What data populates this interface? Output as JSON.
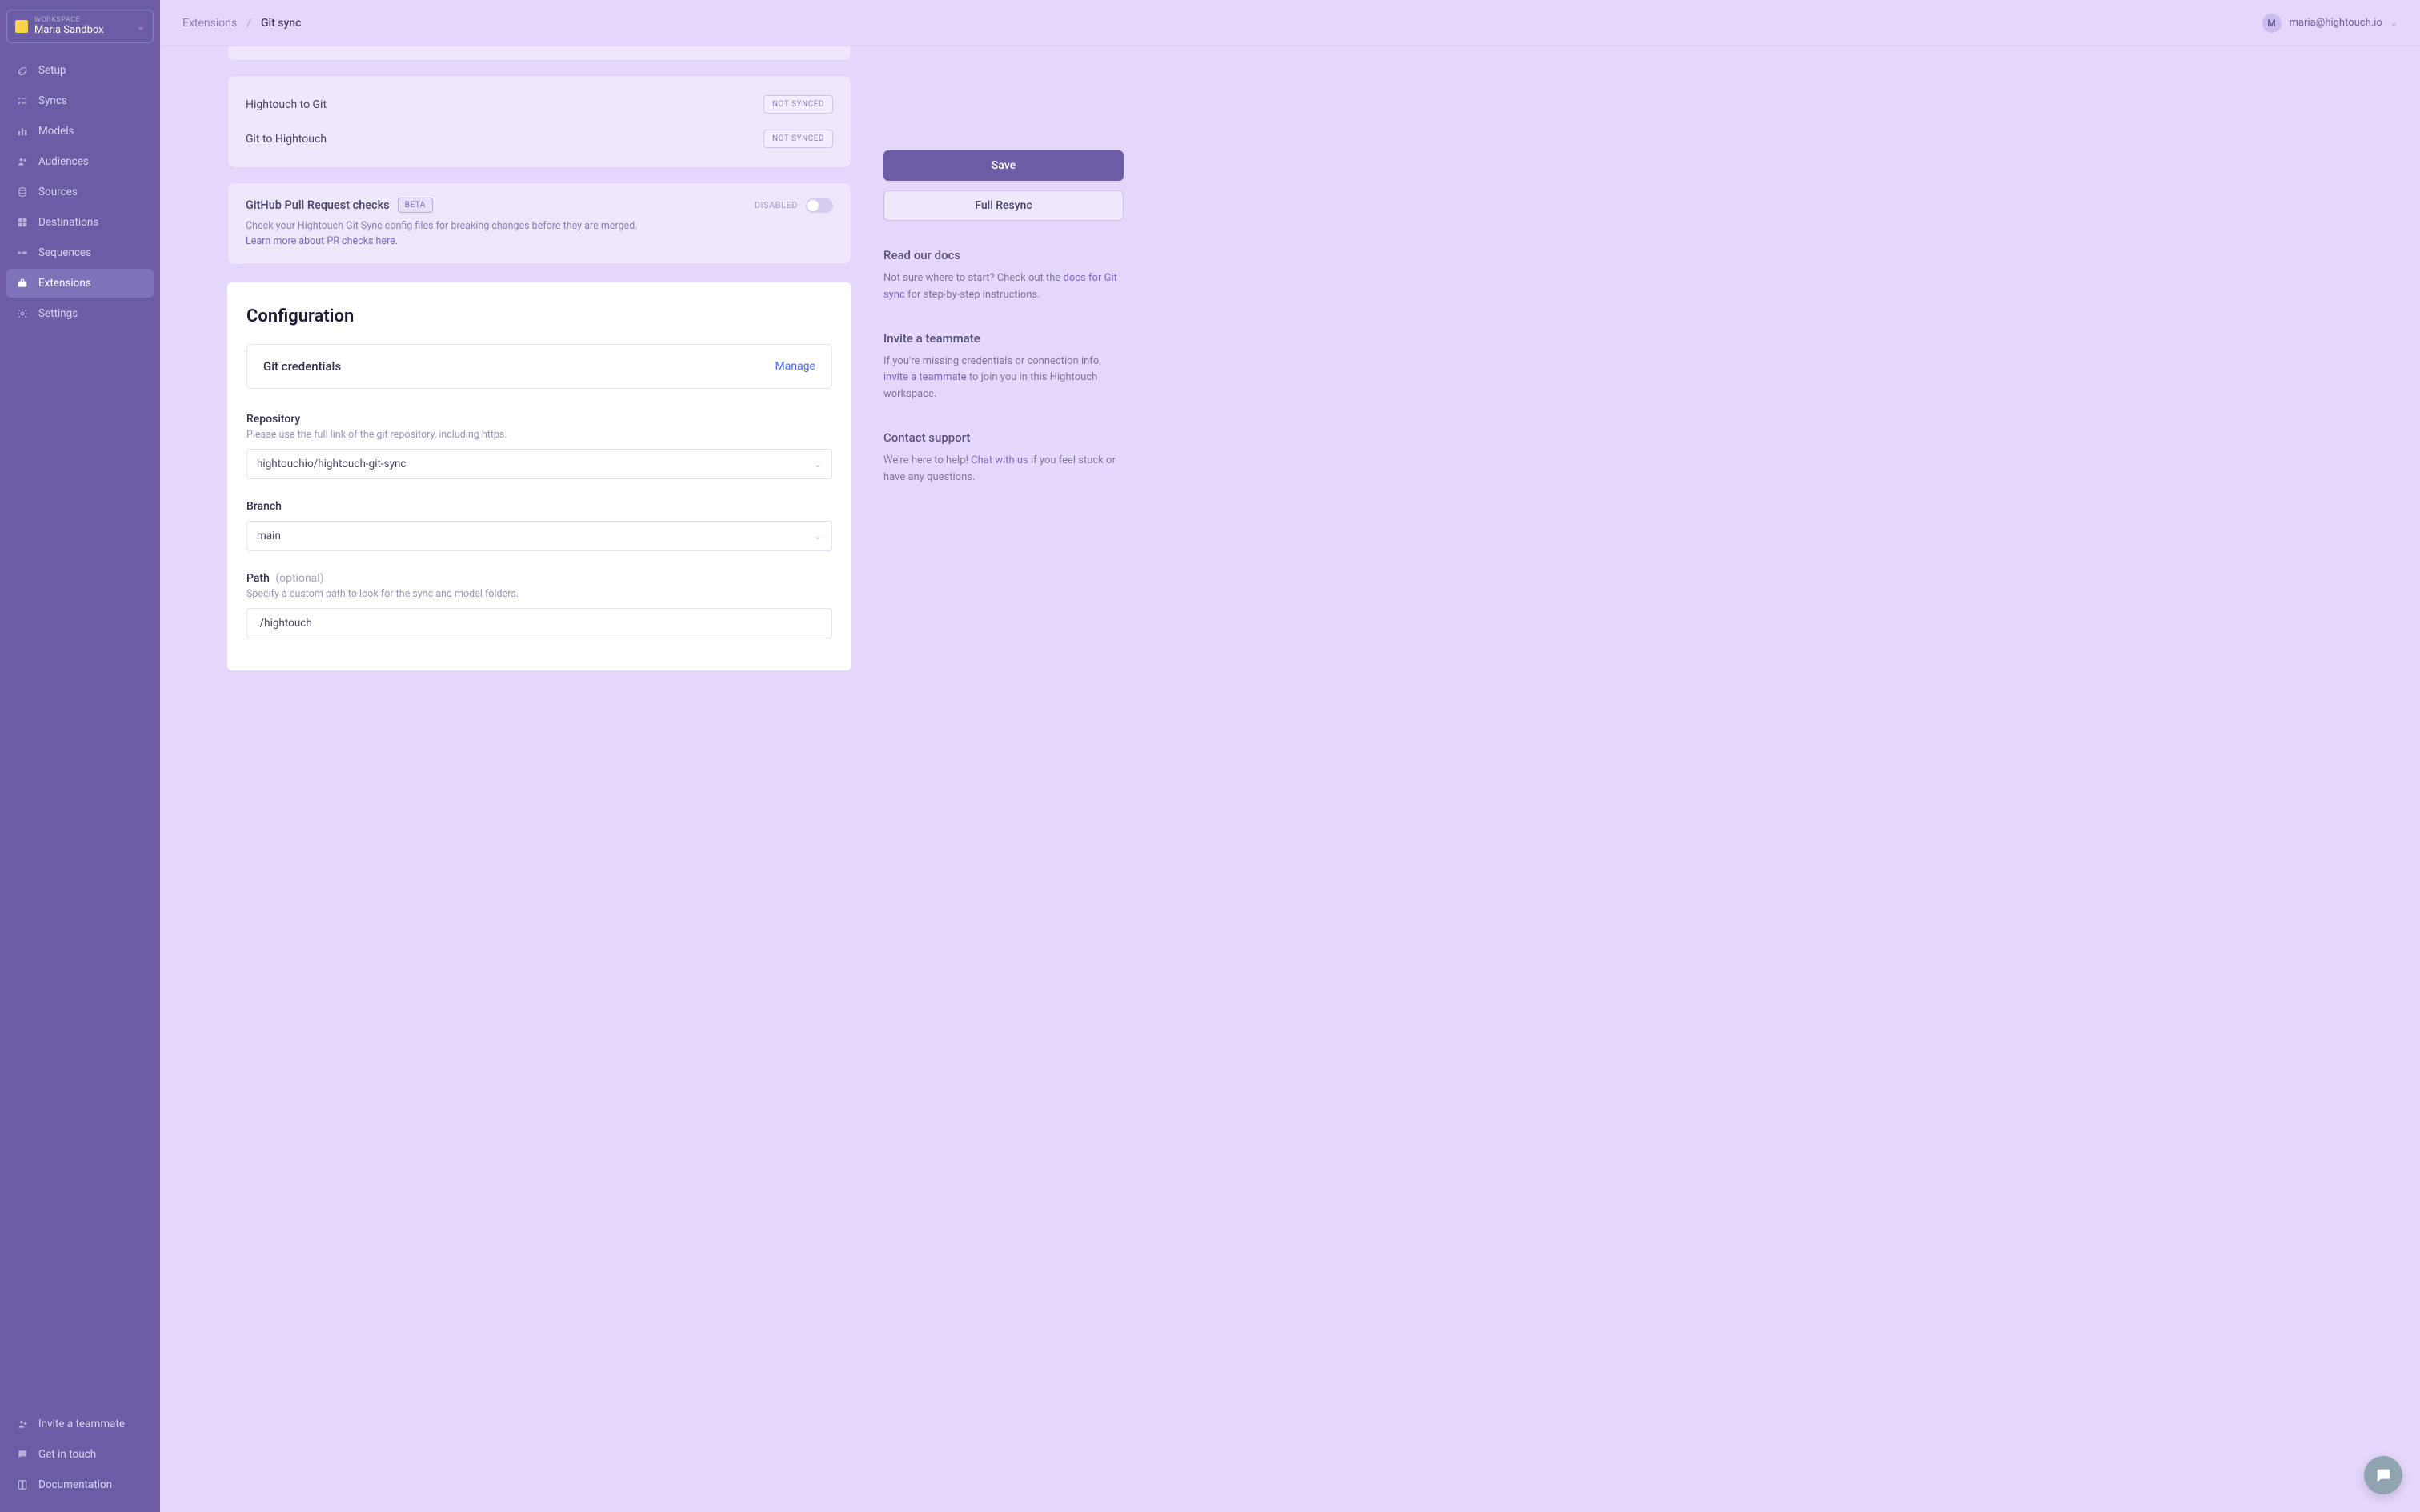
{
  "workspace": {
    "label": "WORKSPACE",
    "name": "Maria Sandbox"
  },
  "sidebar": {
    "items": [
      {
        "label": "Setup"
      },
      {
        "label": "Syncs"
      },
      {
        "label": "Models"
      },
      {
        "label": "Audiences"
      },
      {
        "label": "Sources"
      },
      {
        "label": "Destinations"
      },
      {
        "label": "Sequences"
      },
      {
        "label": "Extensions"
      },
      {
        "label": "Settings"
      }
    ],
    "bottom": [
      {
        "label": "Invite a teammate"
      },
      {
        "label": "Get in touch"
      },
      {
        "label": "Documentation"
      }
    ]
  },
  "breadcrumb": {
    "prev": "Extensions",
    "current": "Git sync"
  },
  "user": {
    "initial": "M",
    "email": "maria@hightouch.io"
  },
  "sync_status": {
    "h2g": {
      "label": "Hightouch to Git",
      "status": "NOT SYNCED"
    },
    "g2h": {
      "label": "Git to Hightouch",
      "status": "NOT SYNCED"
    }
  },
  "pr_checks": {
    "title": "GitHub Pull Request checks",
    "beta": "BETA",
    "state_label": "DISABLED",
    "desc": "Check your Hightouch Git Sync config files for breaking changes before they are merged.",
    "link": "Learn more about PR checks here."
  },
  "config": {
    "title": "Configuration",
    "credentials": {
      "label": "Git credentials",
      "manage": "Manage"
    },
    "repo": {
      "label": "Repository",
      "help": "Please use the full link of the git repository, including https.",
      "value": "hightouchio/hightouch-git-sync"
    },
    "branch": {
      "label": "Branch",
      "value": "main"
    },
    "path": {
      "label": "Path",
      "optional": "(optional)",
      "help": "Specify a custom path to look for the sync and model folders.",
      "value": "./hightouch"
    }
  },
  "actions": {
    "save": "Save",
    "resync": "Full Resync"
  },
  "docs": {
    "title": "Read our docs",
    "text_a": "Not sure where to start? Check out the ",
    "link": "docs for Git sync",
    "text_b": " for step-by-step instructions."
  },
  "invite": {
    "title": "Invite a teammate",
    "text_a": "If you're missing credentials or connection info, ",
    "link": "invite a teammate",
    "text_b": " to join you in this Hightouch workspace."
  },
  "support": {
    "title": "Contact support",
    "text_a": "We're here to help! ",
    "link": "Chat with us",
    "text_b": " if you feel stuck or have any questions."
  }
}
